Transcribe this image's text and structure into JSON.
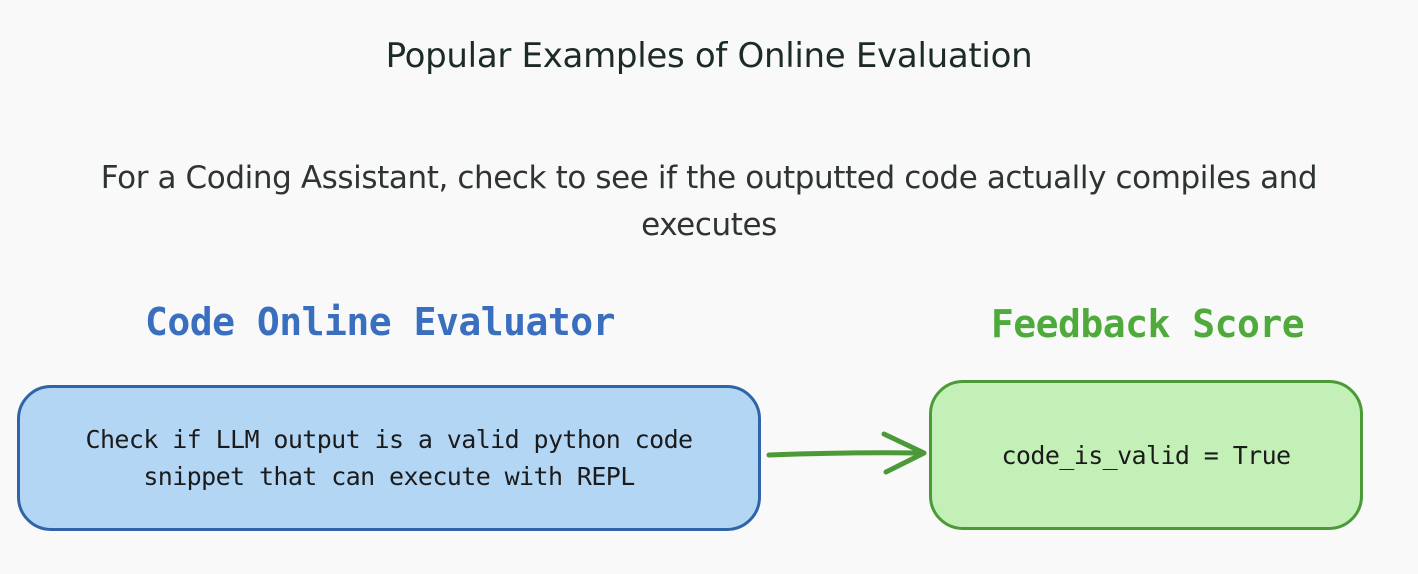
{
  "title": "Popular Examples of Online Evaluation",
  "subtitle": "For a Coding Assistant, check to see if the outputted code actually compiles and executes",
  "diagram": {
    "left_heading": "Code Online Evaluator",
    "right_heading": "Feedback Score",
    "left_box_text": "Check if LLM output is a valid python code snippet that can execute with REPL",
    "right_box_text": "code_is_valid = True"
  },
  "colors": {
    "background": "#f8f9f8",
    "left_heading": "#3a6ebf",
    "right_heading": "#4faa3c",
    "left_box_fill": "#b3d6f5",
    "left_box_stroke": "#2f65a8",
    "right_box_fill": "#c3f0b6",
    "right_box_stroke": "#4c9a37",
    "arrow": "#4c9a37"
  }
}
